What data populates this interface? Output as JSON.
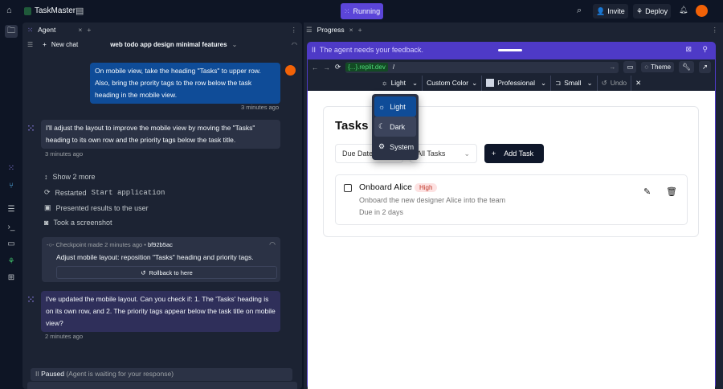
{
  "app": {
    "name": "TaskMaster",
    "status": "Running",
    "invite": "Invite",
    "deploy": "Deploy"
  },
  "agent": {
    "tab": "Agent",
    "new_chat": "New chat",
    "chat_title": "web todo app design minimal features",
    "messages": [
      {
        "role": "user",
        "text": "On mobile view, take the heading \"Tasks\" to upper row. Also, bring the prority tags to the row below the task heading in the mobile view.",
        "time": "3 minutes ago"
      },
      {
        "role": "agent",
        "text": "I'll adjust the layout to improve the mobile view by moving the \"Tasks\" heading to its own row and the priority tags below the task title.",
        "time": "3 minutes ago"
      },
      {
        "role": "agent",
        "text": "I've updated the mobile layout. Can you check if: 1. The 'Tasks' heading is on its own row, and 2. The priority tags appear below the task title on mobile view?",
        "time": "2 minutes ago"
      }
    ],
    "steps": {
      "show_more": "Show 2 more",
      "restarted": "Restarted",
      "restarted_code": "Start application",
      "presented": "Presented results to the user",
      "screenshot": "Took a screenshot"
    },
    "checkpoint": {
      "label": "Checkpoint made",
      "time": "2 minutes ago",
      "hash": "bf92b5ac",
      "desc": "Adjust mobile layout: reposition \"Tasks\" heading and priority tags.",
      "rollback": "Rollback to here"
    },
    "paused": "Paused",
    "paused_note": "(Agent is waiting for your response)"
  },
  "progress": {
    "tab": "Progress",
    "feedback": "The agent needs your feedback.",
    "url_domain": "{...}.replit.dev",
    "url_path": "/",
    "theme": "Theme",
    "toolbar": {
      "mode": "Light",
      "color": "Custom Color",
      "style": "Professional",
      "size": "Small",
      "undo": "Undo"
    },
    "menu": [
      "Light",
      "Dark",
      "System"
    ]
  },
  "app_preview": {
    "title": "Tasks",
    "sort": "Due Date",
    "filter": "All Tasks",
    "add": "Add Task",
    "task": {
      "title": "Onboard Alice",
      "priority": "High",
      "desc": "Onboard the new designer Alice into the team",
      "due": "Due in 2 days"
    }
  },
  "colors": {
    "accent": "#4e3ac7",
    "user_bubble": "#0f4c98",
    "agent_bubble": "#2b3245"
  }
}
